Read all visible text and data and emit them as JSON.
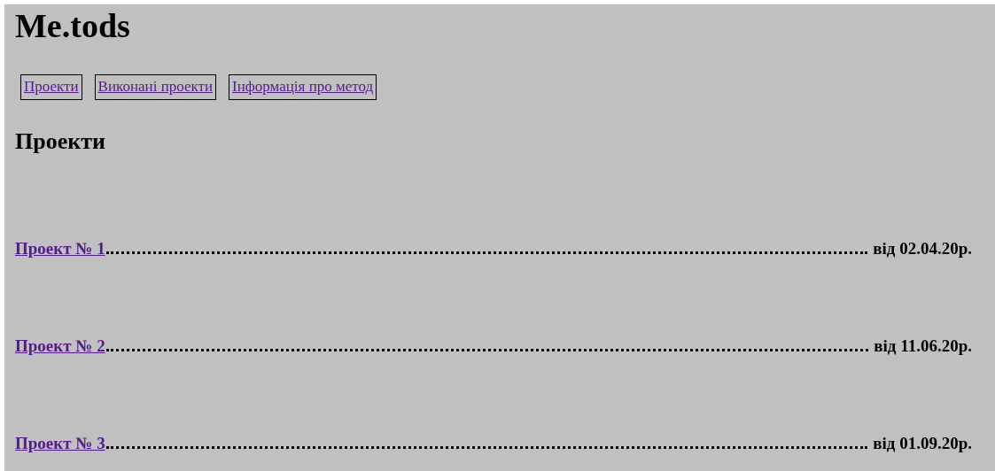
{
  "site_title": "Me.tods",
  "nav": [
    {
      "label": "Проекти"
    },
    {
      "label": "Виконані проекти"
    },
    {
      "label": "Інформація про метод"
    }
  ],
  "heading": "Проекти",
  "projects": [
    {
      "name": "Проект № 1",
      "date": "від 02.04.20р."
    },
    {
      "name": "Проект № 2",
      "date": "від 11.06.20р."
    },
    {
      "name": "Проект № 3",
      "date": "від 01.09.20р."
    }
  ]
}
